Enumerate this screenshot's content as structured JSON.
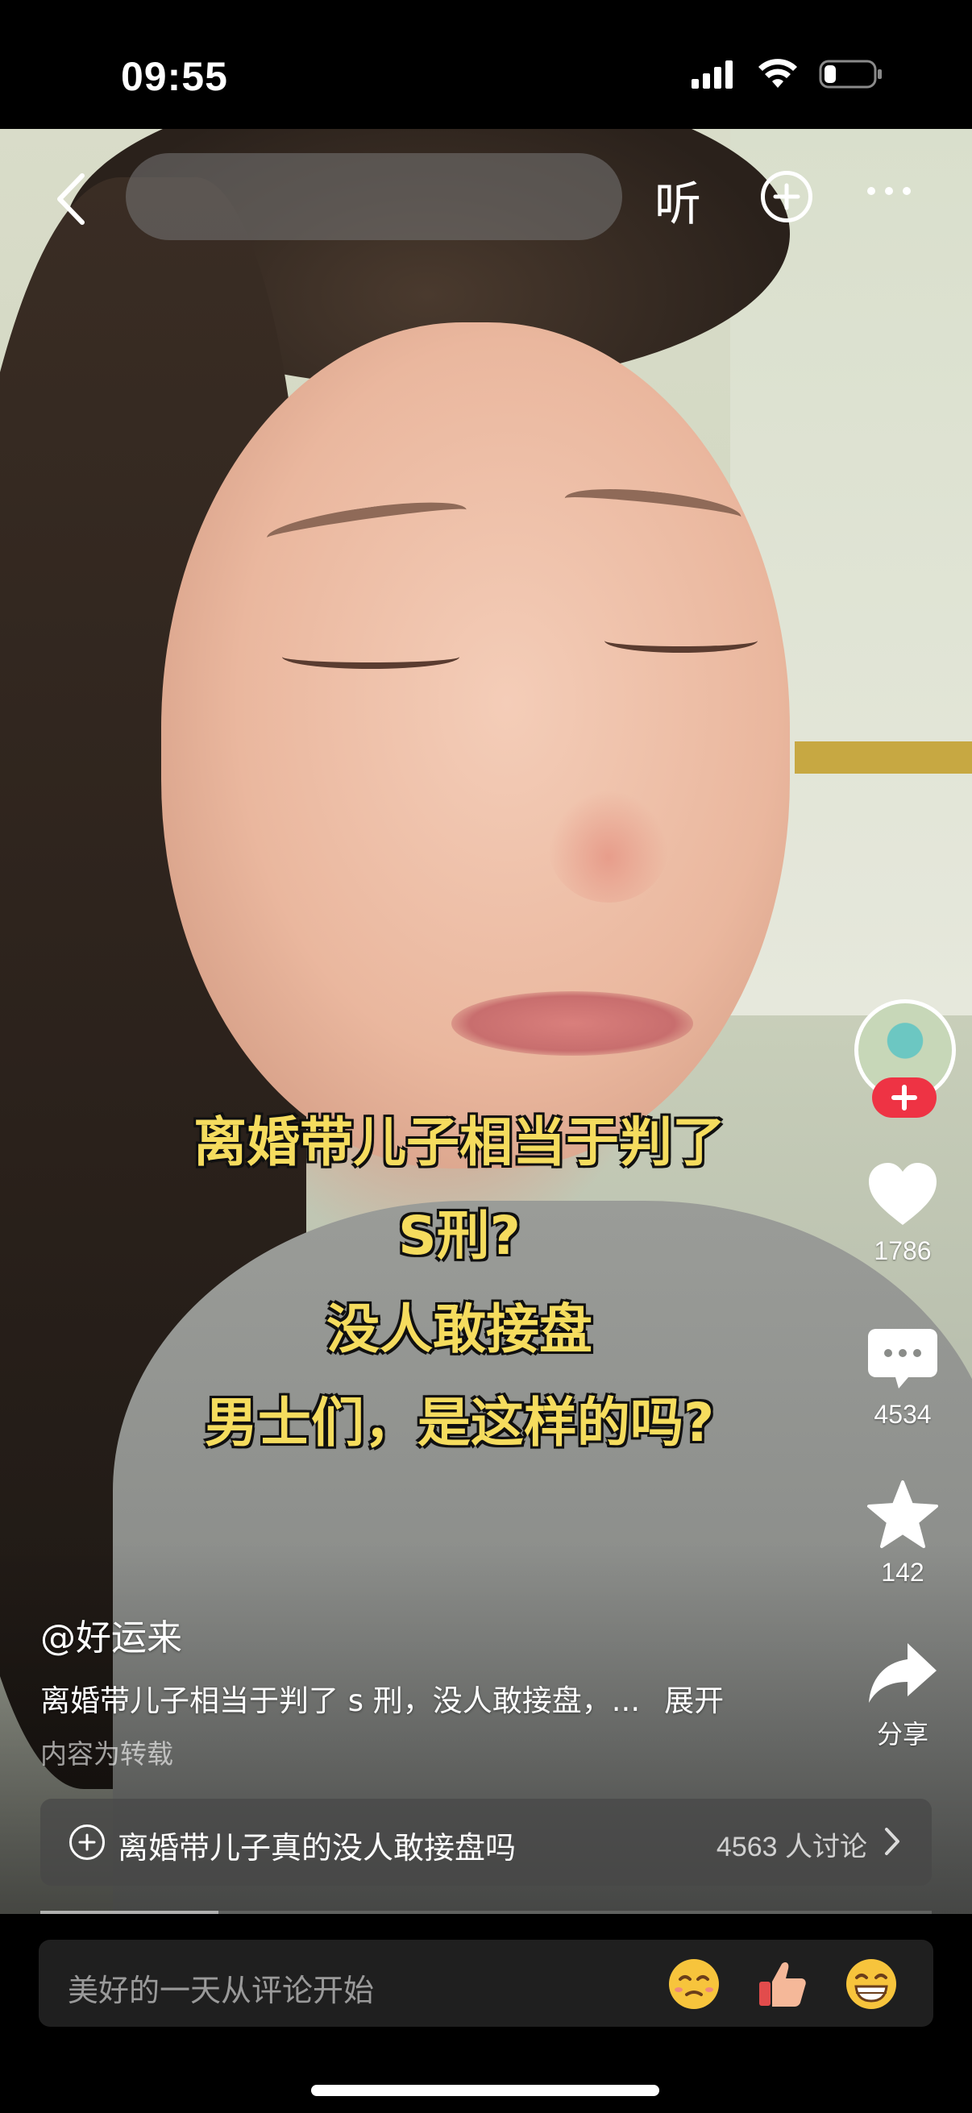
{
  "status": {
    "time": "09:55"
  },
  "nav": {
    "search_placeholder": "",
    "listen_label": "听"
  },
  "caption": {
    "line1": "离婚带儿子相当于判了",
    "line2": "S刑?",
    "line3": "没人敢接盘",
    "line4": "男士们，是这样的吗?"
  },
  "actions": {
    "likes": "1786",
    "comments": "4534",
    "favorites": "142",
    "share": "分享"
  },
  "post": {
    "author": "@好运来",
    "description": "离婚带儿子相当于判了 s 刑，没人敢接盘，...",
    "expand": "展开",
    "repost_note": "内容为转载"
  },
  "topic": {
    "text": "离婚带儿子真的没人敢接盘吗",
    "count": "4563 人讨论"
  },
  "progress": {
    "fraction": 0.2
  },
  "comment": {
    "placeholder": "美好的一天从评论开始"
  },
  "colors": {
    "caption": "#f5dc5e",
    "follow_badge": "#ee3344"
  },
  "icons": [
    "back-icon",
    "plus-icon",
    "more-icon",
    "heart-icon",
    "comment-icon",
    "star-icon",
    "share-icon",
    "chevron-right-icon",
    "emoji-pleading-icon",
    "emoji-thumbs-up-icon",
    "emoji-grin-icon"
  ]
}
